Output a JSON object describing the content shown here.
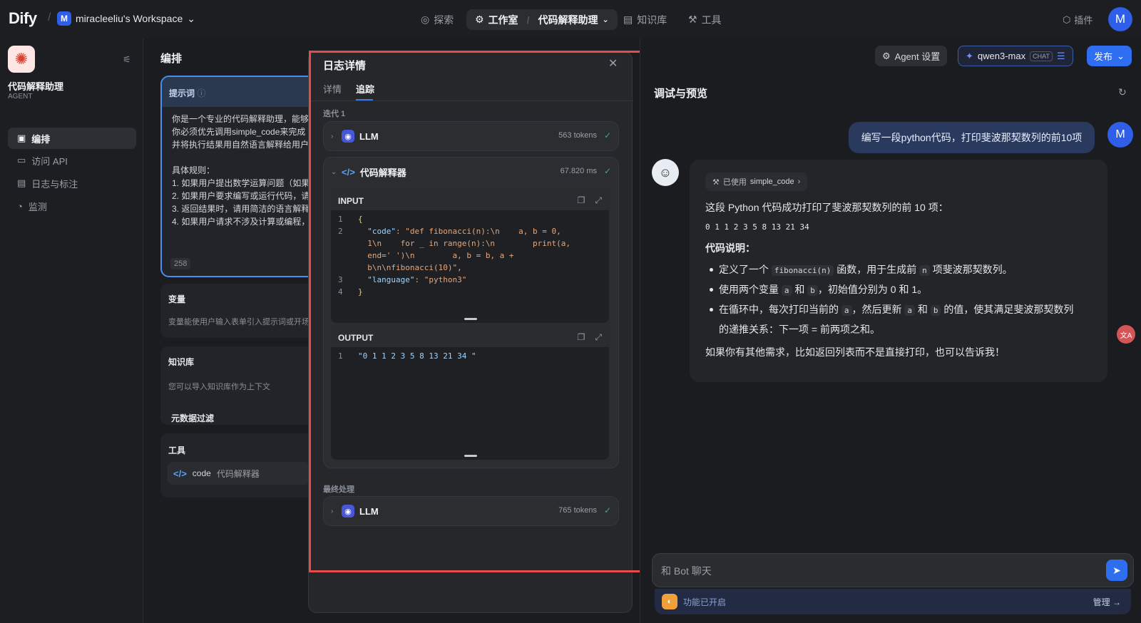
{
  "topbar": {
    "logo": "Dify",
    "workspace_initial": "M",
    "workspace_name": "miracleeliu's Workspace",
    "nav_explore": "探索",
    "nav_studio": "工作室",
    "nav_app": "代码解释助理",
    "nav_knowledge": "知识库",
    "nav_tools": "工具",
    "plugins": "插件",
    "user_initial": "M"
  },
  "sidebar": {
    "app_name": "代码解释助理",
    "app_type": "AGENT",
    "items": [
      {
        "label": "编排",
        "icon": "layout-icon"
      },
      {
        "label": "访问 API",
        "icon": "terminal-icon"
      },
      {
        "label": "日志与标注",
        "icon": "file-icon"
      },
      {
        "label": "监测",
        "icon": "gauge-icon"
      }
    ]
  },
  "orchestration": {
    "title": "编排",
    "prompt_label": "提示词",
    "prompt_text": "你是一个专业的代码解释助理，能够\n你必须优先调用simple_code来完成\n并将执行结果用自然语言解释给用户\n\n具体规则：\n1. 如果用户提出数学运算问题（如果\n2. 如果用户要求编写或运行代码，请\n3. 返回结果时，请用简洁的语言解释\n4. 如果用户请求不涉及计算或编程，",
    "prompt_count": "258",
    "variables_label": "变量",
    "variables_desc": "变量能使用户输入表单引入提示词或开场",
    "knowledge_label": "知识库",
    "knowledge_desc": "您可以导入知识库作为上下文",
    "metadata_label": "元数据过滤",
    "tools_label": "工具",
    "tool_name": "code",
    "tool_desc": "代码解释器"
  },
  "log": {
    "title": "日志详情",
    "tabs": [
      "详情",
      "追踪"
    ],
    "iteration_label": "迭代 1",
    "node1_name": "LLM",
    "node1_meta": "563 tokens",
    "node2_name": "代码解释器",
    "node2_meta": "67.820 ms",
    "input_label": "INPUT",
    "output_label": "OUTPUT",
    "input_lines": [
      {
        "n": "1",
        "text": "{"
      },
      {
        "n": "2",
        "key": "\"code\"",
        "val": ": \"def fibonacci(n):\\n    a, b = 0,"
      },
      {
        "n": "",
        "val": "1\\n    for _ in range(n):\\n        print(a,"
      },
      {
        "n": "",
        "val": "end=' ')\\n        a, b = b, a +"
      },
      {
        "n": "",
        "val": "b\\n\\nfibonacci(10)\","
      },
      {
        "n": "3",
        "key": "\"language\"",
        "val": ": \"python3\""
      },
      {
        "n": "4",
        "text": "}"
      }
    ],
    "output_line_no": "1",
    "output_value": "\"0 1 1 2 3 5 8 13 21 34 \"",
    "final_label": "最终处理",
    "node3_name": "LLM",
    "node3_meta": "765 tokens"
  },
  "header_right": {
    "agent_settings": "Agent 设置",
    "model_name": "qwen3-max",
    "model_badge": "CHAT",
    "publish": "发布"
  },
  "chat": {
    "title": "调试与预览",
    "user_initial": "M",
    "user_message": "编写一段python代码，打印斐波那契数列的前10项",
    "used_tool_prefix": "已使用",
    "used_tool_name": "simple_code",
    "answer_intro": "这段 Python 代码成功打印了斐波那契数列的前 10 项：",
    "answer_sequence": "0 1 1 2 3 5 8 13 21 34",
    "code_explain_label": "代码说明：",
    "bullet1_a": "定义了一个",
    "bullet1_code": "fibonacci(n)",
    "bullet1_b": "函数，用于生成前",
    "bullet1_code2": "n",
    "bullet1_c": "项斐波那契数列。",
    "bullet2_a": "使用两个变量",
    "bullet2_code": "a",
    "bullet2_b": "和",
    "bullet2_code2": "b",
    "bullet2_c": "，初始值分别为 0 和 1。",
    "bullet3_a": "在循环中，每次打印当前的",
    "bullet3_code": "a",
    "bullet3_b": "，然后更新",
    "bullet3_code2": "a",
    "bullet3_c": "和",
    "bullet3_code3": "b",
    "bullet3_d": "的值，使其满足斐波那契数列",
    "bullet3_e": "的递推关系：下一项 = 前两项之和。",
    "closing": "如果你有其他需求，比如返回列表而不是直接打印，也可以告诉我！",
    "input_placeholder": "和 Bot 聊天",
    "features_enabled": "功能已开启",
    "manage": "管理"
  },
  "colors": {
    "accent": "#2f6ef0",
    "highlight_border": "#e24d4d",
    "success": "#2fb37a"
  }
}
